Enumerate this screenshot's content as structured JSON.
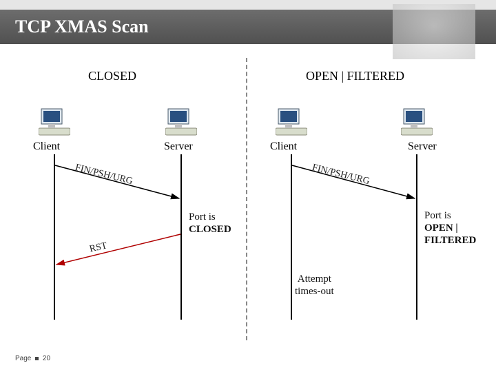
{
  "title": "TCP XMAS Scan",
  "footer_page_label": "Page",
  "footer_page_num": "20",
  "closed": {
    "heading": "CLOSED",
    "client_label": "Client",
    "server_label": "Server",
    "packet1": "FIN/PSH/URG",
    "packet2": "RST",
    "note_line1": "Port is",
    "note_line2": "CLOSED"
  },
  "open": {
    "heading": "OPEN | FILTERED",
    "client_label": "Client",
    "server_label": "Server",
    "packet1": "FIN/PSH/URG",
    "note_line1": "Port is",
    "note_line2": "OPEN |",
    "note_line3": "FILTERED",
    "timeout_line1": "Attempt",
    "timeout_line2": "times-out"
  }
}
